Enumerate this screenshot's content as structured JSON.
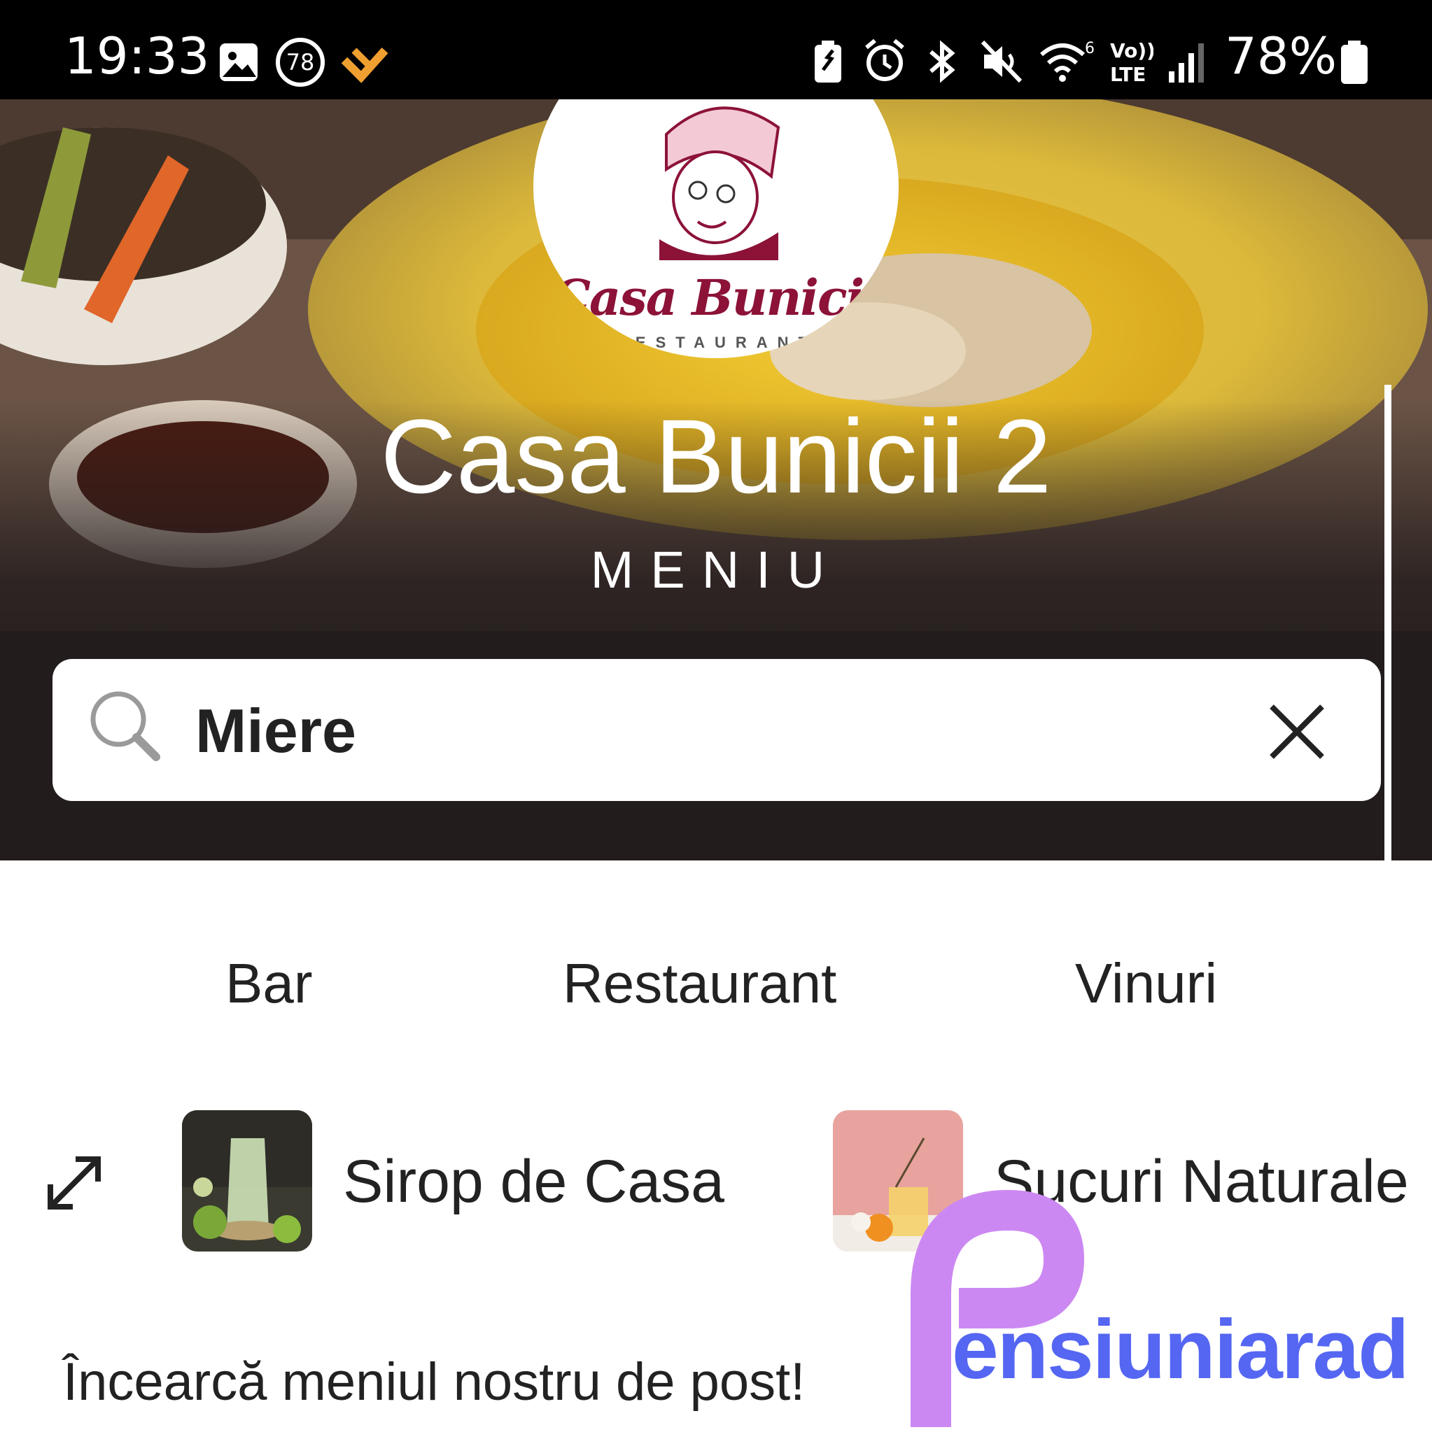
{
  "status_bar": {
    "time": "19:33",
    "notification_badge": "78",
    "battery": "78%"
  },
  "hero": {
    "logo_name": "Casa Bunicii",
    "logo_subtitle": "RESTAURANT",
    "title": "Casa Bunicii 2",
    "subtitle": "MENIU"
  },
  "search": {
    "value": "Miere"
  },
  "tabs": [
    {
      "label": "Bar"
    },
    {
      "label": "Restaurant"
    },
    {
      "label": "Vinuri"
    }
  ],
  "categories": [
    {
      "label": "Sirop de Casa"
    },
    {
      "label": "Sucuri Naturale"
    }
  ],
  "promo_text": "Încearcă meniul nostru de post!",
  "watermark": {
    "text": "ensiuniarad"
  }
}
